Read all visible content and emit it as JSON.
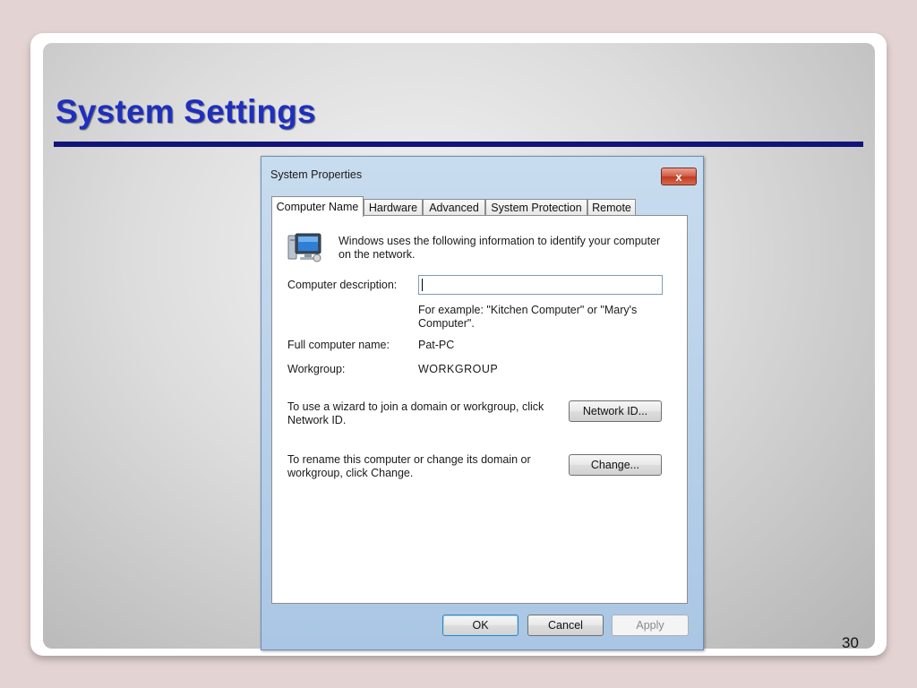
{
  "slide": {
    "title": "System Settings",
    "page_number": "30"
  },
  "dialog": {
    "title": "System Properties",
    "close_label": "x",
    "tabs": [
      {
        "label": "Computer Name",
        "active": true
      },
      {
        "label": "Hardware"
      },
      {
        "label": "Advanced"
      },
      {
        "label": "System Protection"
      },
      {
        "label": "Remote"
      }
    ],
    "intro_line1": "Windows uses the following information to identify your computer",
    "intro_line2": "on the network.",
    "description_label": "Computer description:",
    "description_value": "",
    "example_line1": "For example: \"Kitchen Computer\" or \"Mary's",
    "example_line2": "Computer\".",
    "full_name_label": "Full computer name:",
    "full_name_value": "Pat-PC",
    "workgroup_label": "Workgroup:",
    "workgroup_value": "WORKGROUP",
    "network_text_line1": "To use a wizard to join a domain or workgroup, click",
    "network_text_line2": "Network ID.",
    "network_id_button": "Network ID...",
    "rename_text_line1": "To rename this computer or change its domain or",
    "rename_text_line2": "workgroup, click Change.",
    "change_button": "Change...",
    "ok_button": "OK",
    "cancel_button": "Cancel",
    "apply_button": "Apply",
    "icon": "computer-network-icon"
  }
}
